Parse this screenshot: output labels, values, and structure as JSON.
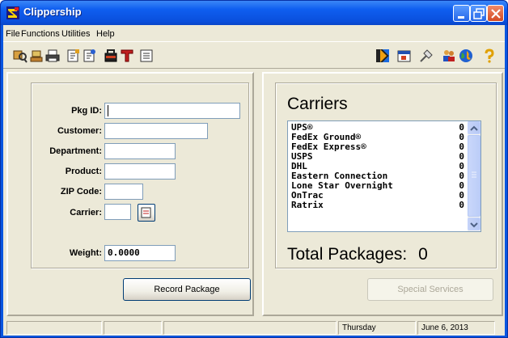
{
  "window": {
    "title": "Clippership"
  },
  "menu": {
    "items": [
      "File",
      "Functions",
      "Utilities",
      "Help"
    ]
  },
  "toolbar": {
    "left_icons": [
      "find-package-icon",
      "scale-icon",
      "print-icon",
      "ship-form-icon",
      "ship-form-alt-icon",
      "bag-icon",
      "text-icon",
      "list-icon"
    ],
    "right_icons": [
      "split-panel-icon",
      "calendar-icon",
      "tools-icon",
      "users-icon",
      "globe-icon",
      "help-icon"
    ]
  },
  "form": {
    "pkg_id_label": "Pkg ID:",
    "customer_label": "Customer:",
    "department_label": "Department:",
    "product_label": "Product:",
    "zip_label": "ZIP Code:",
    "carrier_label": "Carrier:",
    "weight_label": "Weight:",
    "weight_value": "0.0000",
    "record_button": "Record Package"
  },
  "carriers": {
    "title": "Carriers",
    "list": [
      {
        "name": "UPS®",
        "count": "0"
      },
      {
        "name": "FedEx Ground®",
        "count": "0"
      },
      {
        "name": "FedEx Express®",
        "count": "0"
      },
      {
        "name": "USPS",
        "count": "0"
      },
      {
        "name": "DHL",
        "count": "0"
      },
      {
        "name": "Eastern Connection",
        "count": "0"
      },
      {
        "name": "Lone Star Overnight",
        "count": "0"
      },
      {
        "name": "OnTrac",
        "count": "0"
      },
      {
        "name": "Ratrix",
        "count": "0"
      }
    ],
    "total_label": "Total Packages:",
    "total_value": "0",
    "special_services_button": "Special Services"
  },
  "status": {
    "day": "Thursday",
    "date": "June 6, 2013"
  }
}
